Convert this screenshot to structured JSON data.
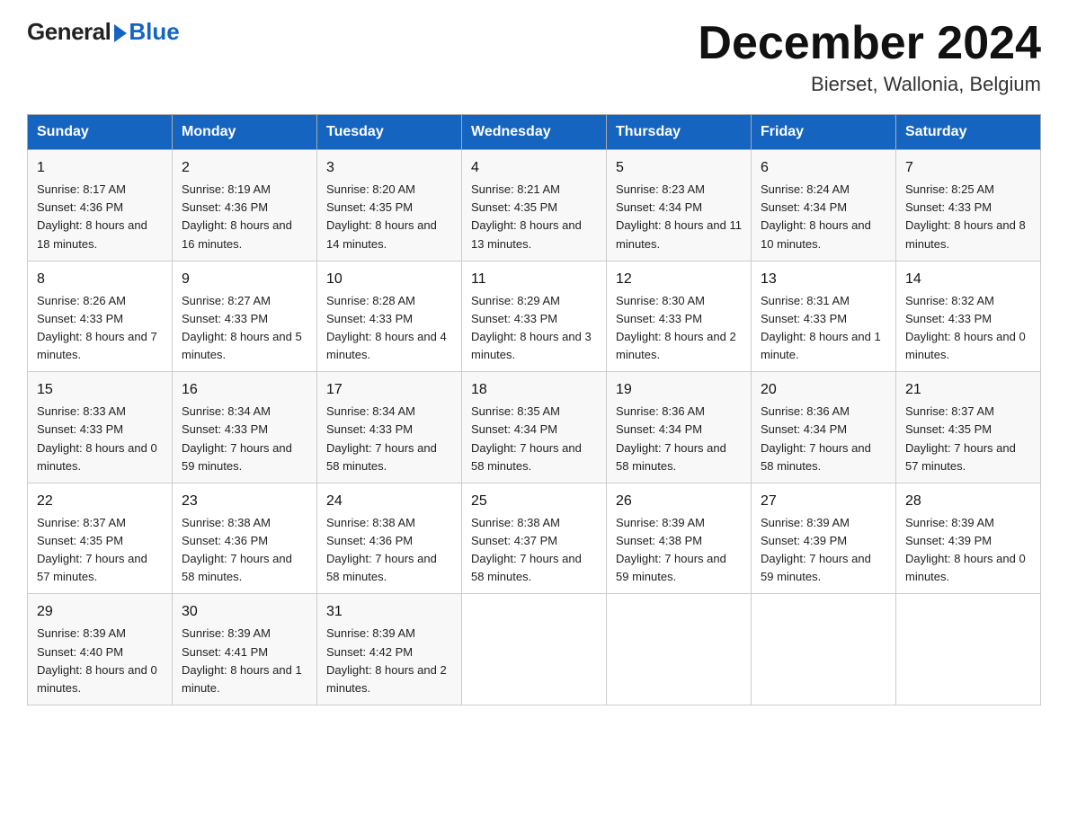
{
  "logo": {
    "general": "General",
    "blue": "Blue"
  },
  "title": "December 2024",
  "location": "Bierset, Wallonia, Belgium",
  "days_of_week": [
    "Sunday",
    "Monday",
    "Tuesday",
    "Wednesday",
    "Thursday",
    "Friday",
    "Saturday"
  ],
  "weeks": [
    [
      {
        "day": 1,
        "sunrise": "Sunrise: 8:17 AM",
        "sunset": "Sunset: 4:36 PM",
        "daylight": "Daylight: 8 hours and 18 minutes."
      },
      {
        "day": 2,
        "sunrise": "Sunrise: 8:19 AM",
        "sunset": "Sunset: 4:36 PM",
        "daylight": "Daylight: 8 hours and 16 minutes."
      },
      {
        "day": 3,
        "sunrise": "Sunrise: 8:20 AM",
        "sunset": "Sunset: 4:35 PM",
        "daylight": "Daylight: 8 hours and 14 minutes."
      },
      {
        "day": 4,
        "sunrise": "Sunrise: 8:21 AM",
        "sunset": "Sunset: 4:35 PM",
        "daylight": "Daylight: 8 hours and 13 minutes."
      },
      {
        "day": 5,
        "sunrise": "Sunrise: 8:23 AM",
        "sunset": "Sunset: 4:34 PM",
        "daylight": "Daylight: 8 hours and 11 minutes."
      },
      {
        "day": 6,
        "sunrise": "Sunrise: 8:24 AM",
        "sunset": "Sunset: 4:34 PM",
        "daylight": "Daylight: 8 hours and 10 minutes."
      },
      {
        "day": 7,
        "sunrise": "Sunrise: 8:25 AM",
        "sunset": "Sunset: 4:33 PM",
        "daylight": "Daylight: 8 hours and 8 minutes."
      }
    ],
    [
      {
        "day": 8,
        "sunrise": "Sunrise: 8:26 AM",
        "sunset": "Sunset: 4:33 PM",
        "daylight": "Daylight: 8 hours and 7 minutes."
      },
      {
        "day": 9,
        "sunrise": "Sunrise: 8:27 AM",
        "sunset": "Sunset: 4:33 PM",
        "daylight": "Daylight: 8 hours and 5 minutes."
      },
      {
        "day": 10,
        "sunrise": "Sunrise: 8:28 AM",
        "sunset": "Sunset: 4:33 PM",
        "daylight": "Daylight: 8 hours and 4 minutes."
      },
      {
        "day": 11,
        "sunrise": "Sunrise: 8:29 AM",
        "sunset": "Sunset: 4:33 PM",
        "daylight": "Daylight: 8 hours and 3 minutes."
      },
      {
        "day": 12,
        "sunrise": "Sunrise: 8:30 AM",
        "sunset": "Sunset: 4:33 PM",
        "daylight": "Daylight: 8 hours and 2 minutes."
      },
      {
        "day": 13,
        "sunrise": "Sunrise: 8:31 AM",
        "sunset": "Sunset: 4:33 PM",
        "daylight": "Daylight: 8 hours and 1 minute."
      },
      {
        "day": 14,
        "sunrise": "Sunrise: 8:32 AM",
        "sunset": "Sunset: 4:33 PM",
        "daylight": "Daylight: 8 hours and 0 minutes."
      }
    ],
    [
      {
        "day": 15,
        "sunrise": "Sunrise: 8:33 AM",
        "sunset": "Sunset: 4:33 PM",
        "daylight": "Daylight: 8 hours and 0 minutes."
      },
      {
        "day": 16,
        "sunrise": "Sunrise: 8:34 AM",
        "sunset": "Sunset: 4:33 PM",
        "daylight": "Daylight: 7 hours and 59 minutes."
      },
      {
        "day": 17,
        "sunrise": "Sunrise: 8:34 AM",
        "sunset": "Sunset: 4:33 PM",
        "daylight": "Daylight: 7 hours and 58 minutes."
      },
      {
        "day": 18,
        "sunrise": "Sunrise: 8:35 AM",
        "sunset": "Sunset: 4:34 PM",
        "daylight": "Daylight: 7 hours and 58 minutes."
      },
      {
        "day": 19,
        "sunrise": "Sunrise: 8:36 AM",
        "sunset": "Sunset: 4:34 PM",
        "daylight": "Daylight: 7 hours and 58 minutes."
      },
      {
        "day": 20,
        "sunrise": "Sunrise: 8:36 AM",
        "sunset": "Sunset: 4:34 PM",
        "daylight": "Daylight: 7 hours and 58 minutes."
      },
      {
        "day": 21,
        "sunrise": "Sunrise: 8:37 AM",
        "sunset": "Sunset: 4:35 PM",
        "daylight": "Daylight: 7 hours and 57 minutes."
      }
    ],
    [
      {
        "day": 22,
        "sunrise": "Sunrise: 8:37 AM",
        "sunset": "Sunset: 4:35 PM",
        "daylight": "Daylight: 7 hours and 57 minutes."
      },
      {
        "day": 23,
        "sunrise": "Sunrise: 8:38 AM",
        "sunset": "Sunset: 4:36 PM",
        "daylight": "Daylight: 7 hours and 58 minutes."
      },
      {
        "day": 24,
        "sunrise": "Sunrise: 8:38 AM",
        "sunset": "Sunset: 4:36 PM",
        "daylight": "Daylight: 7 hours and 58 minutes."
      },
      {
        "day": 25,
        "sunrise": "Sunrise: 8:38 AM",
        "sunset": "Sunset: 4:37 PM",
        "daylight": "Daylight: 7 hours and 58 minutes."
      },
      {
        "day": 26,
        "sunrise": "Sunrise: 8:39 AM",
        "sunset": "Sunset: 4:38 PM",
        "daylight": "Daylight: 7 hours and 59 minutes."
      },
      {
        "day": 27,
        "sunrise": "Sunrise: 8:39 AM",
        "sunset": "Sunset: 4:39 PM",
        "daylight": "Daylight: 7 hours and 59 minutes."
      },
      {
        "day": 28,
        "sunrise": "Sunrise: 8:39 AM",
        "sunset": "Sunset: 4:39 PM",
        "daylight": "Daylight: 8 hours and 0 minutes."
      }
    ],
    [
      {
        "day": 29,
        "sunrise": "Sunrise: 8:39 AM",
        "sunset": "Sunset: 4:40 PM",
        "daylight": "Daylight: 8 hours and 0 minutes."
      },
      {
        "day": 30,
        "sunrise": "Sunrise: 8:39 AM",
        "sunset": "Sunset: 4:41 PM",
        "daylight": "Daylight: 8 hours and 1 minute."
      },
      {
        "day": 31,
        "sunrise": "Sunrise: 8:39 AM",
        "sunset": "Sunset: 4:42 PM",
        "daylight": "Daylight: 8 hours and 2 minutes."
      },
      null,
      null,
      null,
      null
    ]
  ]
}
